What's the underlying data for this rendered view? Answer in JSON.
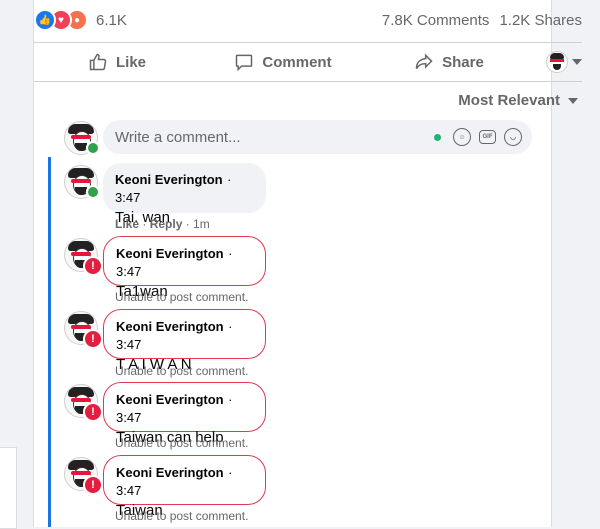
{
  "stats": {
    "reaction_count": "6.1K",
    "comments": "7.8K Comments",
    "shares": "1.2K Shares"
  },
  "actions": {
    "like": "Like",
    "comment": "Comment",
    "share": "Share"
  },
  "sort": {
    "label": "Most Relevant"
  },
  "write": {
    "placeholder": "Write a comment..."
  },
  "comments": [
    {
      "author": "Keoni Everington",
      "time": "· 3:47",
      "text": "Tai. wan",
      "meta_like": "Like",
      "meta_sep": " · ",
      "meta_reply": "Reply",
      "meta_age": " · 1m"
    },
    {
      "author": "Keoni Everington",
      "time": "· 3:47",
      "text": "Ta1wan",
      "error": "Unable to post comment."
    },
    {
      "author": "Keoni Everington",
      "time": "· 3:47",
      "text": "T A I W A N",
      "error": "Unable to post comment."
    },
    {
      "author": "Keoni Everington",
      "time": "· 3:47",
      "text": "Taiwan can help",
      "error": "Unable to post comment."
    },
    {
      "author": "Keoni Everington",
      "time": "· 3:47",
      "text": "Taiwan",
      "error": "Unable to post comment."
    }
  ],
  "colors": {
    "thread_line": "#1b74e4",
    "error": "#e41e3f",
    "online": "#31a24c"
  }
}
